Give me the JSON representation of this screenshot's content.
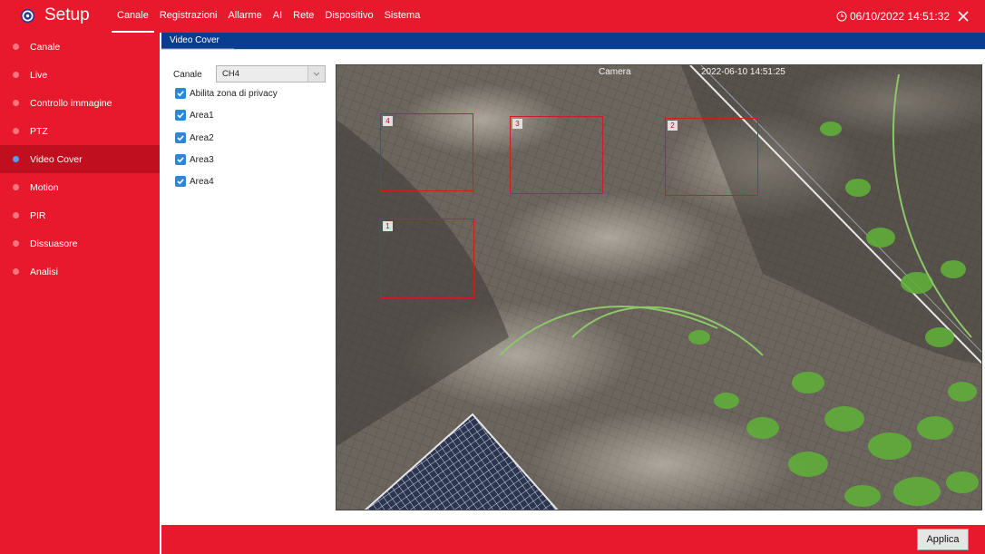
{
  "header": {
    "title": "Setup",
    "tabs": [
      "Canale",
      "Registrazioni",
      "Allarme",
      "AI",
      "Rete",
      "Dispositivo",
      "Sistema"
    ],
    "active_tab": "Canale",
    "datetime": "06/10/2022 14:51:32"
  },
  "sidebar": {
    "items": [
      {
        "label": "Canale"
      },
      {
        "label": "Live"
      },
      {
        "label": "Controllo immagine"
      },
      {
        "label": "PTZ"
      },
      {
        "label": "Video Cover"
      },
      {
        "label": "Motion"
      },
      {
        "label": "PIR"
      },
      {
        "label": "Dissuasore"
      },
      {
        "label": "Analisi"
      }
    ],
    "active_item": "Video Cover"
  },
  "section": {
    "tab_label": "Video Cover"
  },
  "form": {
    "channel_label": "Canale",
    "channel_value": "CH4",
    "enable_privacy_label": "Abilita zona di privacy",
    "enable_privacy_checked": true,
    "areas": [
      {
        "label": "Area1",
        "checked": true
      },
      {
        "label": "Area2",
        "checked": true
      },
      {
        "label": "Area3",
        "checked": true
      },
      {
        "label": "Area4",
        "checked": true
      }
    ]
  },
  "preview": {
    "camera_name": "Camera",
    "timestamp": "2022-06-10 14:51:25",
    "zones": [
      "1",
      "2",
      "3",
      "4"
    ]
  },
  "footer": {
    "apply_label": "Applica"
  },
  "colors": {
    "accent": "#e8192c",
    "sidebar_active": "#c0101f",
    "section_bar": "#0a3d8e",
    "checkbox": "#2f86d6",
    "zone_border": "#d11a24"
  },
  "icons": {
    "logo": "gear-icon",
    "clock": "clock-icon",
    "close": "close-icon",
    "checkbox": "checkmark-icon",
    "select": "chevron-down-icon"
  }
}
